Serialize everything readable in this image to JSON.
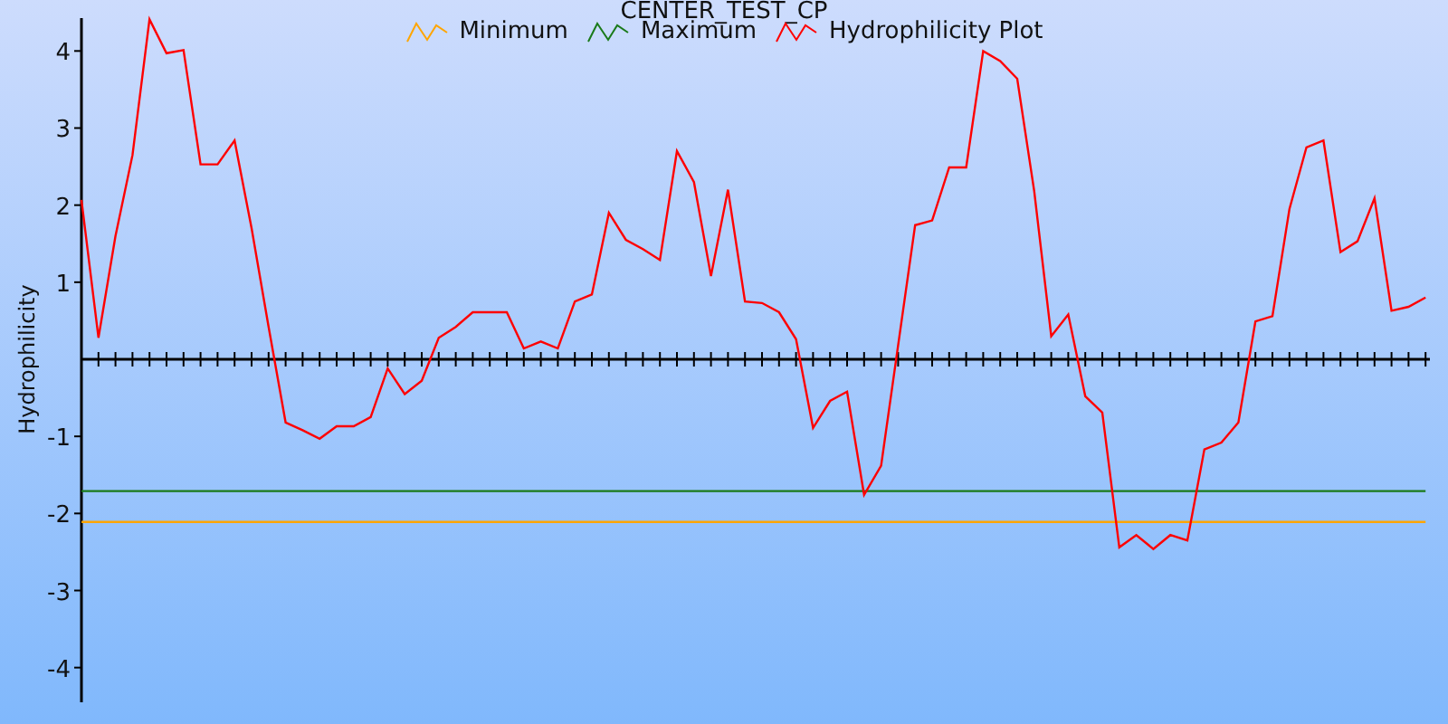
{
  "chart_data": {
    "type": "line",
    "title": "CENTER_TEST_CP",
    "ylabel": "Hydrophilicity",
    "ylim": [
      -4.45,
      4.45
    ],
    "yticks": [
      -4,
      -3,
      -2,
      -1,
      1,
      2,
      3,
      4
    ],
    "series": [
      {
        "name": "Minimum",
        "color": "#ffa500",
        "values": [
          -2.11,
          -2.11,
          -2.11,
          -2.11,
          -2.11,
          -2.11,
          -2.11,
          -2.11,
          -2.11,
          -2.11,
          -2.11,
          -2.11,
          -2.11,
          -2.11,
          -2.11,
          -2.11,
          -2.11,
          -2.11,
          -2.11,
          -2.11,
          -2.11,
          -2.11,
          -2.11,
          -2.11,
          -2.11,
          -2.11,
          -2.11,
          -2.11,
          -2.11,
          -2.11,
          -2.11,
          -2.11,
          -2.11,
          -2.11,
          -2.11,
          -2.11,
          -2.11,
          -2.11,
          -2.11,
          -2.11,
          -2.11,
          -2.11,
          -2.11,
          -2.11,
          -2.11,
          -2.11,
          -2.11,
          -2.11,
          -2.11,
          -2.11,
          -2.11,
          -2.11,
          -2.11,
          -2.11,
          -2.11,
          -2.11,
          -2.11,
          -2.11,
          -2.11,
          -2.11,
          -2.11,
          -2.11,
          -2.11,
          -2.11,
          -2.11,
          -2.11,
          -2.11,
          -2.11,
          -2.11,
          -2.11,
          -2.11,
          -2.11,
          -2.11,
          -2.11,
          -2.11,
          -2.11,
          -2.11,
          -2.11,
          -2.11,
          -2.11
        ]
      },
      {
        "name": "Maximum",
        "color": "#1a7a1a",
        "values": [
          -1.71,
          -1.71,
          -1.71,
          -1.71,
          -1.71,
          -1.71,
          -1.71,
          -1.71,
          -1.71,
          -1.71,
          -1.71,
          -1.71,
          -1.71,
          -1.71,
          -1.71,
          -1.71,
          -1.71,
          -1.71,
          -1.71,
          -1.71,
          -1.71,
          -1.71,
          -1.71,
          -1.71,
          -1.71,
          -1.71,
          -1.71,
          -1.71,
          -1.71,
          -1.71,
          -1.71,
          -1.71,
          -1.71,
          -1.71,
          -1.71,
          -1.71,
          -1.71,
          -1.71,
          -1.71,
          -1.71,
          -1.71,
          -1.71,
          -1.71,
          -1.71,
          -1.71,
          -1.71,
          -1.71,
          -1.71,
          -1.71,
          -1.71,
          -1.71,
          -1.71,
          -1.71,
          -1.71,
          -1.71,
          -1.71,
          -1.71,
          -1.71,
          -1.71,
          -1.71,
          -1.71,
          -1.71,
          -1.71,
          -1.71,
          -1.71,
          -1.71,
          -1.71,
          -1.71,
          -1.71,
          -1.71,
          -1.71,
          -1.71,
          -1.71,
          -1.71,
          -1.71,
          -1.71,
          -1.71,
          -1.71,
          -1.71,
          -1.71
        ]
      },
      {
        "name": "Hydrophilicity Plot",
        "color": "#ff0000",
        "values": [
          2.07,
          0.28,
          1.6,
          2.65,
          4.41,
          3.97,
          4.01,
          2.53,
          2.53,
          2.84,
          1.7,
          0.42,
          -0.82,
          -0.92,
          -1.03,
          -0.87,
          -0.87,
          -0.75,
          -0.12,
          -0.45,
          -0.28,
          0.28,
          0.42,
          0.61,
          0.61,
          0.61,
          0.14,
          0.23,
          0.14,
          0.75,
          0.84,
          1.9,
          1.55,
          1.43,
          1.29,
          2.7,
          2.3,
          1.08,
          2.2,
          0.75,
          0.73,
          0.61,
          0.26,
          -0.89,
          -0.54,
          -0.42,
          -1.76,
          -1.38,
          0.18,
          1.74,
          1.8,
          2.49,
          2.49,
          4.0,
          3.87,
          3.64,
          2.18,
          0.3,
          0.58,
          -0.48,
          -0.69,
          -2.44,
          -2.28,
          -2.46,
          -2.28,
          -2.35,
          -1.17,
          -1.08,
          -0.82,
          0.49,
          0.56,
          1.95,
          2.75,
          2.84,
          1.39,
          1.53,
          2.09,
          0.63,
          0.68,
          0.8
        ]
      }
    ]
  }
}
